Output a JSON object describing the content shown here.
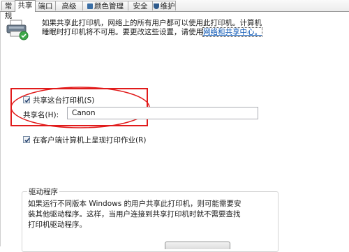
{
  "tabs": [
    {
      "label": "常规",
      "active": false
    },
    {
      "label": "共享",
      "active": true
    },
    {
      "label": "端口",
      "active": false
    },
    {
      "label": "高级",
      "active": false
    },
    {
      "label": "颜色管理",
      "active": false,
      "icon": "color-icon"
    },
    {
      "label": "安全",
      "active": false
    },
    {
      "label": "维护",
      "active": false,
      "icon": "maintenance-icon"
    }
  ],
  "intro": {
    "line1": "如果共享此打印机，网络上的所有用户都可以使用此打印机。计算机",
    "line2_prefix": "睡眠时打印机将不可用。要更改这些设置，请使用",
    "link": "网络和共享中心。"
  },
  "share": {
    "checkbox_label": "共享这台打印机(S)",
    "checked": true,
    "name_label": "共享名(H):",
    "name_value": "Canon"
  },
  "render_jobs": {
    "checkbox_label": "在客户端计算机上呈现打印作业(R)",
    "checked": true
  },
  "drivers": {
    "group_title": "驱动程序",
    "text_line1": "如果运行不同版本 Windows 的用户共享此打印机，则可能需要安",
    "text_line2": "装其他驱动程序。这样，当用户连接到共享打印机时就不需要查找",
    "text_line3": "打印机驱动程序。"
  },
  "colors": {
    "highlight": "#e11b1b",
    "link": "#0a56b5"
  }
}
